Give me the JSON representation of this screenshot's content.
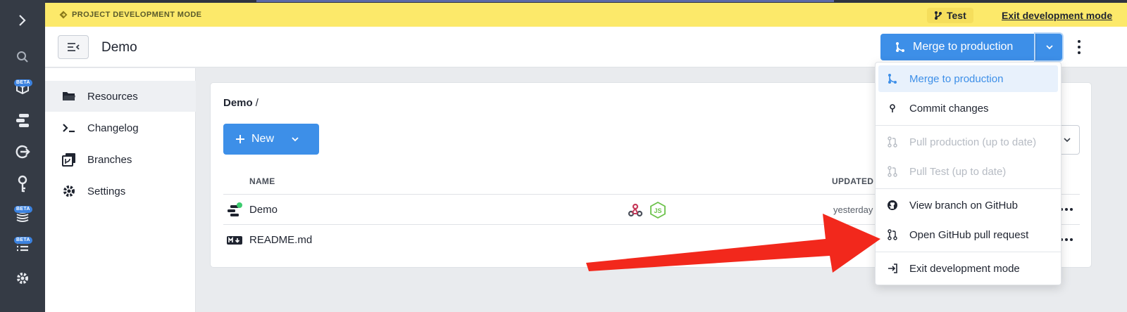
{
  "banner": {
    "mode_label": "PROJECT DEVELOPMENT MODE",
    "branch_name": "Test",
    "exit_link": "Exit development mode",
    "background_color": "#fce96a"
  },
  "header": {
    "title": "Demo",
    "merge_button_label": "Merge to production",
    "accent_color": "#3d8fe8"
  },
  "rail": {
    "items": [
      {
        "icon": "chevron-right-icon"
      },
      {
        "icon": "search-icon"
      },
      {
        "icon": "box-icon",
        "badge": "BETA"
      },
      {
        "icon": "workflow-icon"
      },
      {
        "icon": "exit-icon"
      },
      {
        "icon": "key-icon"
      },
      {
        "icon": "database-icon",
        "badge": "BETA"
      },
      {
        "icon": "list-icon",
        "badge": "BETA"
      },
      {
        "icon": "gear-icon"
      }
    ]
  },
  "sidebar": {
    "items": [
      {
        "label": "Resources",
        "icon": "folder-icon",
        "active": true
      },
      {
        "label": "Changelog",
        "icon": "terminal-icon"
      },
      {
        "label": "Branches",
        "icon": "branch-icon"
      },
      {
        "label": "Settings",
        "icon": "gear-icon"
      }
    ]
  },
  "main": {
    "breadcrumb": "Demo",
    "breadcrumb_separator": "/",
    "new_button_label": "New",
    "columns": {
      "name": "NAME",
      "updated": "UPDATED"
    },
    "rows": [
      {
        "name": "Demo",
        "updated": "yesterday",
        "icon": "workflow-icon",
        "status_color": "#3ccb6e",
        "badges": [
          "webhook-icon",
          "nodejs-icon"
        ]
      },
      {
        "name": "README.md",
        "updated": "",
        "icon": "markdown-icon"
      }
    ]
  },
  "menu": {
    "items": [
      {
        "label": "Merge to production",
        "icon": "merge-icon",
        "selected": true
      },
      {
        "label": "Commit changes",
        "icon": "commit-icon"
      },
      {
        "label": "Pull production (up to date)",
        "icon": "pull-request-icon",
        "disabled": true
      },
      {
        "label": "Pull Test (up to date)",
        "icon": "pull-request-icon",
        "disabled": true
      },
      {
        "label": "View branch on GitHub",
        "icon": "github-icon"
      },
      {
        "label": "Open GitHub pull request",
        "icon": "pull-request-icon"
      },
      {
        "label": "Exit development mode",
        "icon": "exit-icon"
      }
    ]
  },
  "annotation": {
    "arrow_color": "#f2281c"
  }
}
